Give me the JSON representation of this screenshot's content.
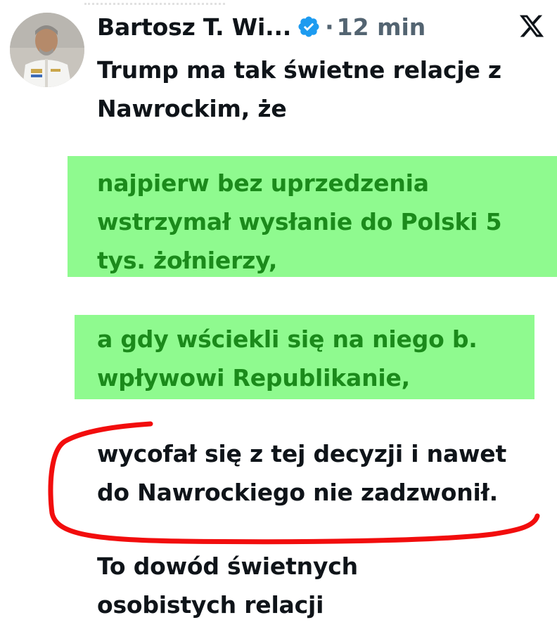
{
  "tweet": {
    "author_name": "Bartosz T. Wi...",
    "verified_icon": "verified-badge-icon",
    "separator": "·",
    "time": "12 min",
    "platform_icon": "x-logo-icon",
    "intro_text": "Trump ma tak świetne relacje z\nNawrockim, że",
    "highlight_1_text": "najpierw bez uprzedzenia\nwstrzymał wysłanie do Polski 5\ntys. żołnierzy,",
    "highlight_2_text": "a gdy wściekli się na niego b.\nwpływowi Republikanie,",
    "circled_text": "wycofał się z tej decyzji i nawet\ndo Nawrockiego nie zadzwonił.",
    "closing_text": "To dowód świetnych\nosobistych relacji"
  },
  "colors": {
    "highlight_bg": "#8ffa8f",
    "highlight_text": "#1b8a1b",
    "annotation_stroke": "#f20d0d",
    "verified_badge": "#1d9bf0",
    "meta_text": "#536471"
  }
}
